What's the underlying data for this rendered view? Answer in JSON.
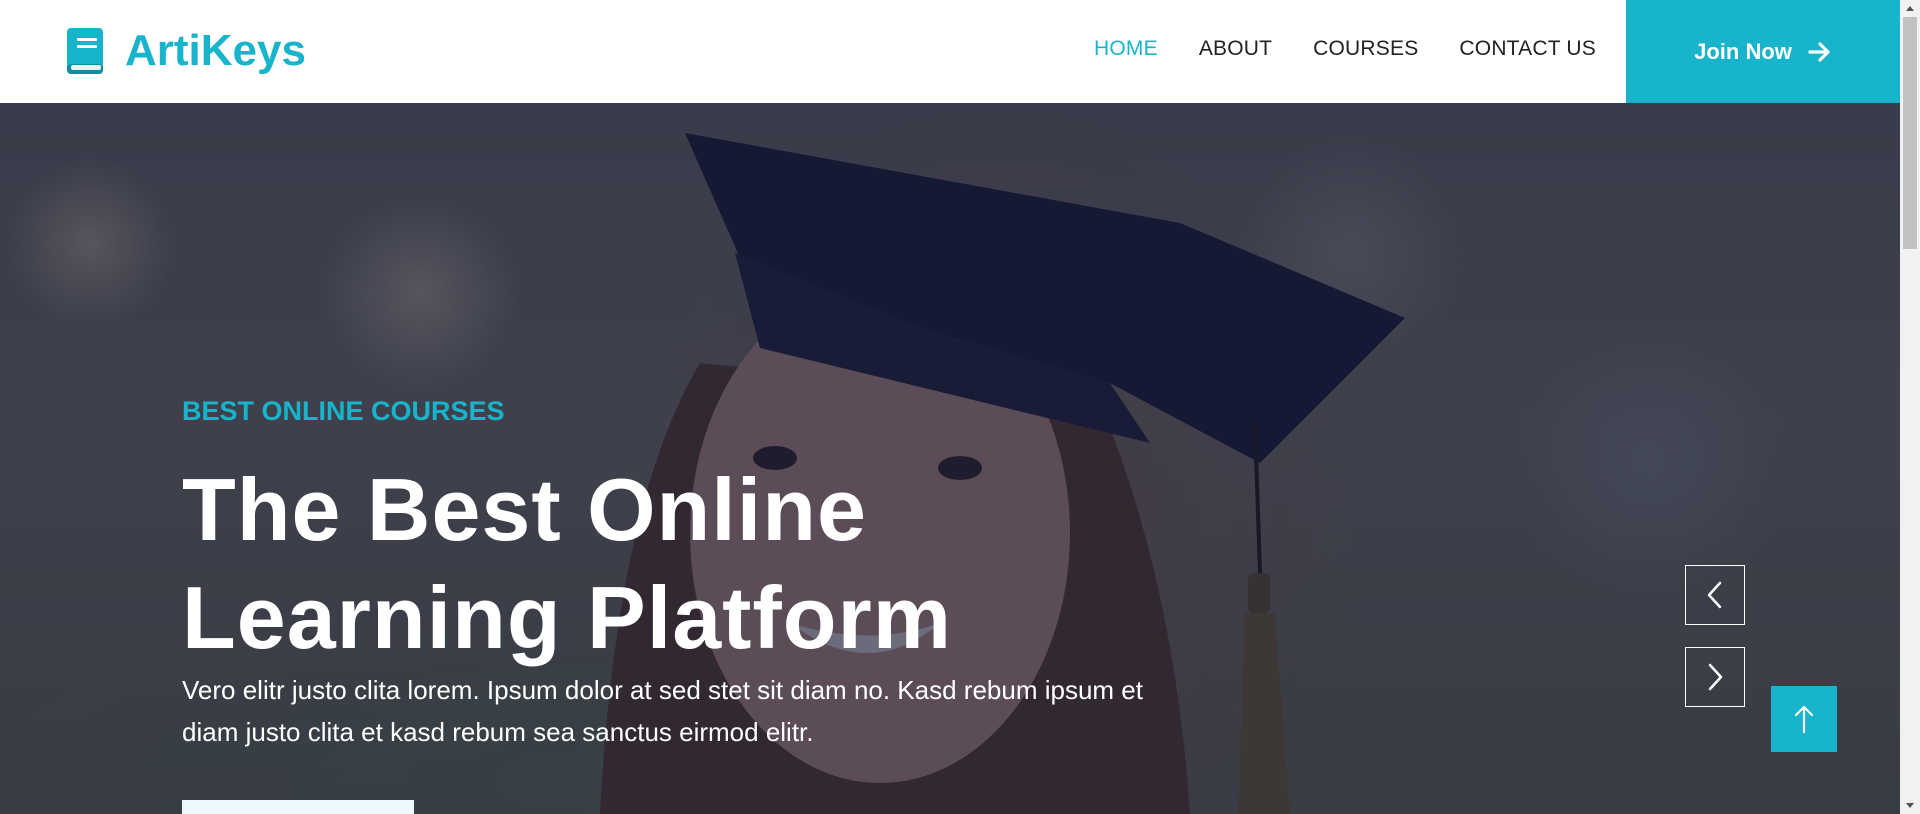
{
  "brand": {
    "name": "ArtiKeys",
    "icon": "book-icon"
  },
  "nav": {
    "items": [
      {
        "label": "HOME",
        "active": true
      },
      {
        "label": "ABOUT",
        "active": false
      },
      {
        "label": "COURSES",
        "active": false
      },
      {
        "label": "CONTACT US",
        "active": false
      }
    ]
  },
  "join": {
    "label": "Join Now",
    "icon": "arrow-right-icon"
  },
  "hero": {
    "subtitle": "BEST ONLINE COURSES",
    "title": "The Best Online Learning Platform",
    "description": "Vero elitr justo clita lorem. Ipsum dolor at sed stet sit diam no. Kasd rebum ipsum et diam justo clita et kasd rebum sea sanctus eirmod elitr.",
    "prev_icon": "chevron-left-icon",
    "next_icon": "chevron-right-icon"
  },
  "back_to_top": {
    "icon": "arrow-up-icon"
  },
  "colors": {
    "accent": "#17b4cc",
    "overlay": "#181d38",
    "text_dark": "#222222"
  }
}
